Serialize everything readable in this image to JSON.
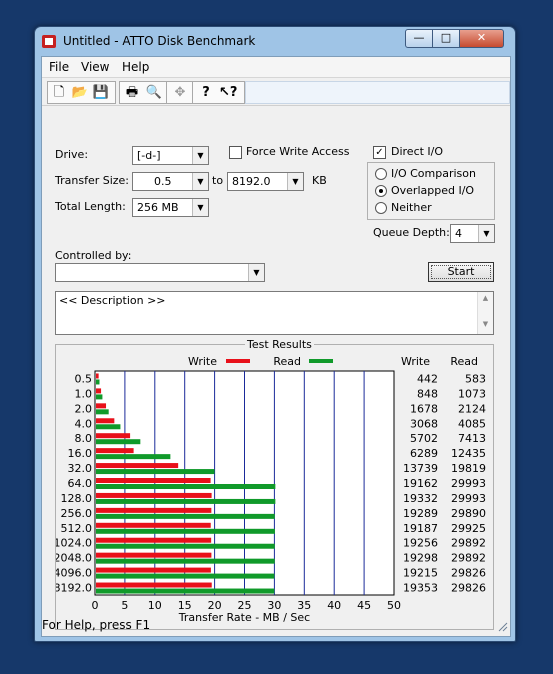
{
  "window": {
    "title": "Untitled - ATTO Disk Benchmark"
  },
  "caption_buttons": {
    "minimize": "—",
    "maximize": "□",
    "close": "✕"
  },
  "menu": [
    "File",
    "View",
    "Help"
  ],
  "toolbar": [
    "new-icon",
    "open-icon",
    "save-icon",
    "print-icon",
    "print-preview-icon",
    "move-icon",
    "help-icon",
    "context-help-icon"
  ],
  "form": {
    "drive_label": "Drive:",
    "drive_value": "[-d-]",
    "force_write_label": "Force Write Access",
    "force_write_checked": false,
    "direct_io_label": "Direct I/O",
    "direct_io_checked": true,
    "transfer_size_label": "Transfer Size:",
    "transfer_from": "0.5",
    "to_label": "to",
    "transfer_to": "8192.0",
    "kb_label": "KB",
    "total_length_label": "Total Length:",
    "total_length_value": "256 MB",
    "io_options": [
      "I/O Comparison",
      "Overlapped I/O",
      "Neither"
    ],
    "io_selected": "Overlapped I/O",
    "queue_depth_label": "Queue Depth:",
    "queue_depth_value": "4",
    "controlled_by_label": "Controlled by:",
    "controlled_by_value": "",
    "start_label": "Start",
    "description_text": "<< Description >>"
  },
  "results": {
    "title": "Test Results",
    "legend_write": "Write",
    "legend_read": "Read",
    "col_write": "Write",
    "col_read": "Read",
    "write_color": "#e8101a",
    "read_color": "#109a2a"
  },
  "chart_data": {
    "type": "bar",
    "orientation": "horizontal",
    "categories": [
      "0.5",
      "1.0",
      "2.0",
      "4.0",
      "8.0",
      "16.0",
      "32.0",
      "64.0",
      "128.0",
      "256.0",
      "512.0",
      "1024.0",
      "2048.0",
      "4096.0",
      "8192.0"
    ],
    "series": [
      {
        "name": "Write",
        "values": [
          442,
          848,
          1678,
          3068,
          5702,
          6289,
          13739,
          19162,
          19332,
          19289,
          19187,
          19256,
          19298,
          19215,
          19353
        ]
      },
      {
        "name": "Read",
        "values": [
          583,
          1073,
          2124,
          4085,
          7413,
          12435,
          19819,
          29993,
          29993,
          29890,
          29925,
          29892,
          29892,
          29826,
          29826
        ]
      }
    ],
    "xlabel": "Transfer Rate - MB / Sec",
    "xticks": [
      "0",
      "5",
      "10",
      "15",
      "20",
      "25",
      "30",
      "35",
      "40",
      "45",
      "50"
    ],
    "xlim": [
      0,
      50
    ]
  },
  "status": {
    "text": "For Help, press F1"
  }
}
